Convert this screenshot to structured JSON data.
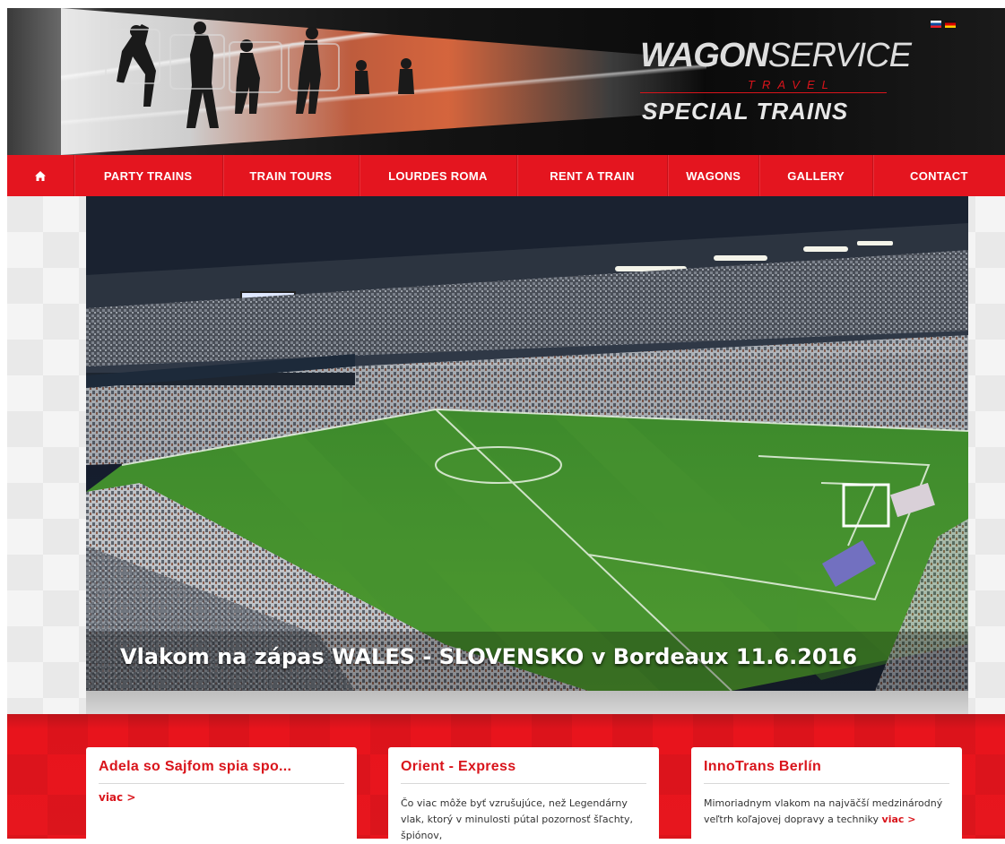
{
  "header": {
    "logo_word1": "WAGON",
    "logo_word2": "SERVICE",
    "logo_travel": "TRAVEL",
    "logo_special": "SPECIAL TRAINS",
    "flags": [
      "sk-flag",
      "de-flag"
    ]
  },
  "nav": {
    "home_icon": "home-icon",
    "items": [
      {
        "label": "PARTY TRAINS"
      },
      {
        "label": "TRAIN TOURS"
      },
      {
        "label": "LOURDES ROMA"
      },
      {
        "label": "RENT A TRAIN"
      },
      {
        "label": "WAGONS"
      },
      {
        "label": "GALLERY"
      },
      {
        "label": "CONTACT"
      }
    ]
  },
  "slider": {
    "caption": "Vlakom na zápas WALES - SLOVENSKO v Bordeaux 11.6.2016"
  },
  "cards": [
    {
      "title": "Adela so Sajfom spia spo...",
      "more": "viac >"
    },
    {
      "title": "Orient - Express",
      "text": "Čo viac môže byť vzrušujúce, než Legendárny vlak, ktorý v minulosti pútal pozornosť šľachty, špiónov,"
    },
    {
      "title": "InnoTrans Berlín",
      "text": "Mimoriadnym vlakom na najväčší medzinárodný veľtrh koľajovej dopravy a techniky ",
      "more": "viac >"
    }
  ],
  "colors": {
    "brand_red": "#e4151f",
    "title_red": "#d9141b"
  }
}
